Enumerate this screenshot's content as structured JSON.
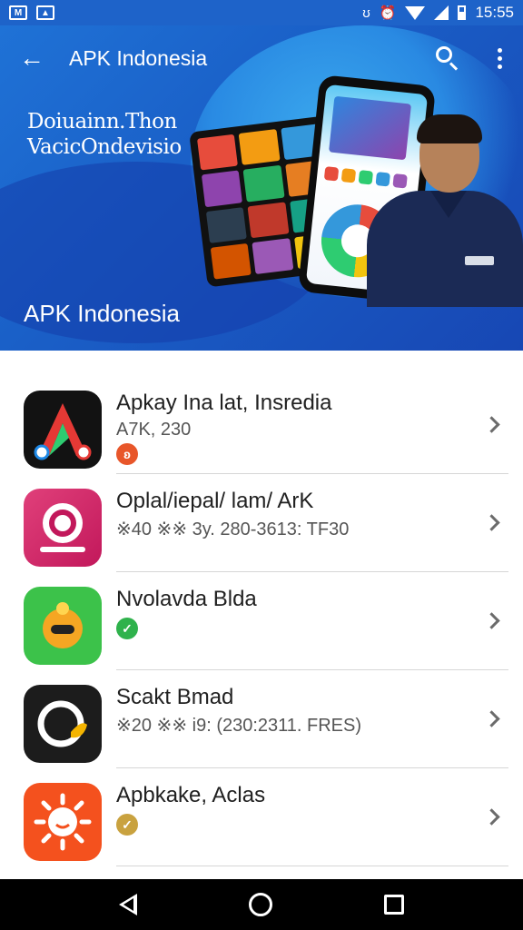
{
  "status_bar": {
    "left_icons": [
      "mail-notification-icon",
      "gallery-notification-icon"
    ],
    "right_icons": [
      "vibrate-icon",
      "alarm-icon",
      "wifi-icon",
      "signal-icon",
      "battery-icon"
    ],
    "time": "15:55"
  },
  "toolbar": {
    "title": "APK Indonesia",
    "back_icon": "arrow-left-icon",
    "search_icon": "search-icon",
    "more_icon": "more-vert-icon"
  },
  "header": {
    "promo_line_1": "Doiuainn.Thon",
    "promo_line_2": "VacicOndevisio",
    "brand": "APK Indonesia"
  },
  "apps": [
    {
      "title": "Apkay Ina lat, Insredia",
      "subtitle": "A7K, 230",
      "badge_glyph": "ʚ",
      "badge_color": "#e8562a"
    },
    {
      "title": "Oplal/iepal/ lam/ ArK",
      "subtitle": "※40 ※※ 3y. 280-3613: TF30",
      "badge_glyph": "",
      "badge_color": ""
    },
    {
      "title": "Nvolavda Blda",
      "subtitle": "",
      "badge_glyph": "✓",
      "badge_color": "#2fb24c"
    },
    {
      "title": "Scakt Bmad",
      "subtitle": "※20 ※※ i9: (230:2311. FRES)",
      "badge_glyph": "",
      "badge_color": ""
    },
    {
      "title": "Apbkake, Aclas",
      "subtitle": "",
      "badge_glyph": "✓",
      "badge_color": "#c9a23f"
    }
  ],
  "colors": {
    "header_blue": "#1a5fc7",
    "status_blue": "#1e63c9",
    "text_primary": "#212121"
  },
  "navigation": {
    "back_icon": "nav-back-icon",
    "home_icon": "nav-home-icon",
    "recents_icon": "nav-recents-icon"
  }
}
